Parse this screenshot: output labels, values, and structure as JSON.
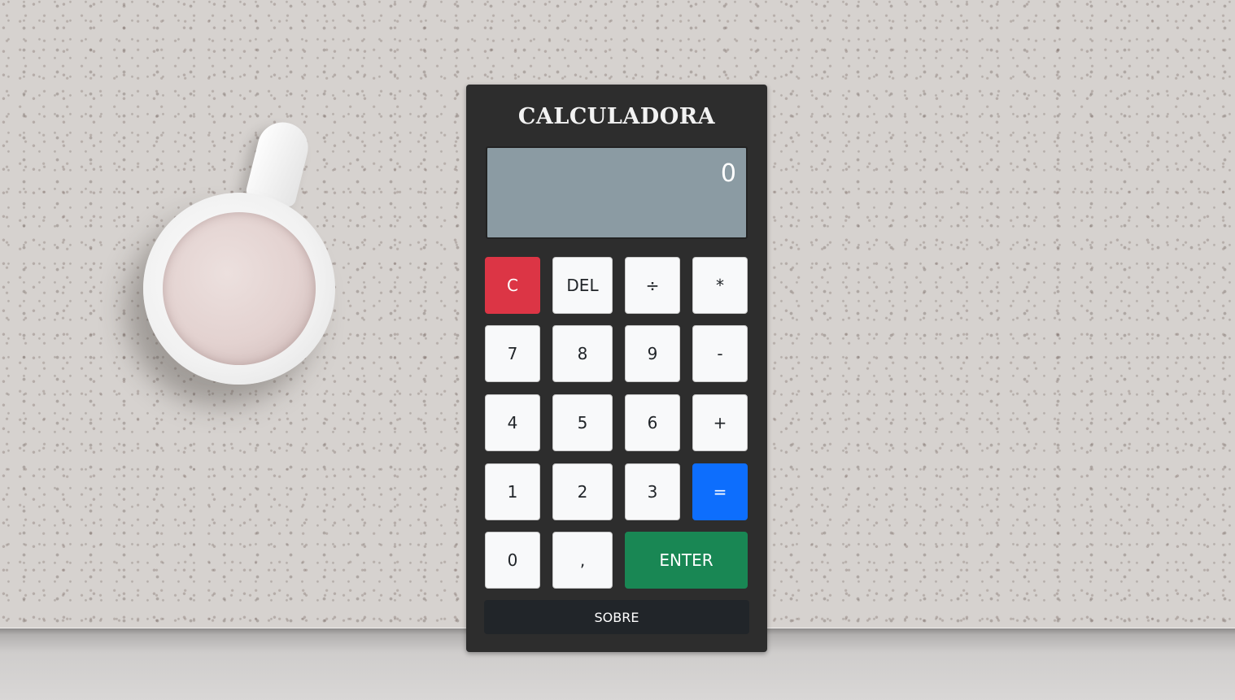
{
  "calculator": {
    "title": "CALCULADORA",
    "display_value": "0",
    "keys": {
      "clear": "C",
      "delete": "DEL",
      "divide": "÷",
      "multiply": "*",
      "seven": "7",
      "eight": "8",
      "nine": "9",
      "subtract": "-",
      "four": "4",
      "five": "5",
      "six": "6",
      "add": "+",
      "one": "1",
      "two": "2",
      "three": "3",
      "equals": "=",
      "zero": "0",
      "comma": ",",
      "enter": "ENTER"
    },
    "about_label": "SOBRE"
  },
  "colors": {
    "panel": "#2d2d2d",
    "display": "#8b9ba3",
    "clear_key": "#dc3545",
    "equals_key": "#0d6efd",
    "enter_key": "#198754",
    "about_button": "#212529"
  }
}
